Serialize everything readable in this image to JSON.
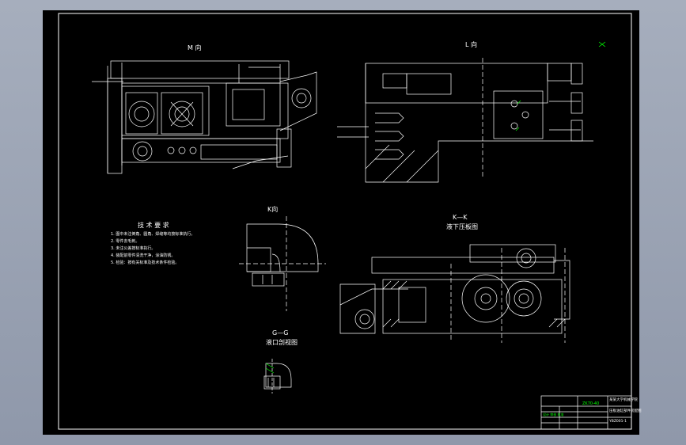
{
  "drawing": {
    "views": {
      "m_view": {
        "title": "M 向"
      },
      "l_view": {
        "title": "L 向"
      },
      "k_view": {
        "title": "K向"
      },
      "kk_section": {
        "title": "K—K",
        "subtitle": "液下压板图"
      },
      "gg_section": {
        "title": "G—G",
        "subtitle": "液口剖视图"
      }
    },
    "tech_requirements": {
      "title": "技 术 要 求",
      "items": [
        "1. 图中未注倒角、圆角、焊缝等均按标准执行。",
        "2. 零件去毛刺。",
        "3. 未注公差按标准执行。",
        "4. 装配前零件清洗干净，涂油防锈。",
        "5. 检验：按有关标准及技术条件检验。"
      ]
    },
    "title_block": {
      "school": "某某大学机械学院",
      "drawing_name": "压板油缸部件装配图",
      "drawing_no": "YBZ001-1",
      "project_code": "ZK70-40",
      "signature_row": "设计 审核 批准"
    },
    "colors": {
      "sheet": "#000000",
      "lines": "#ffffff",
      "accent_green": "#00ff00",
      "frame_bg": "#9aa3b4"
    }
  }
}
